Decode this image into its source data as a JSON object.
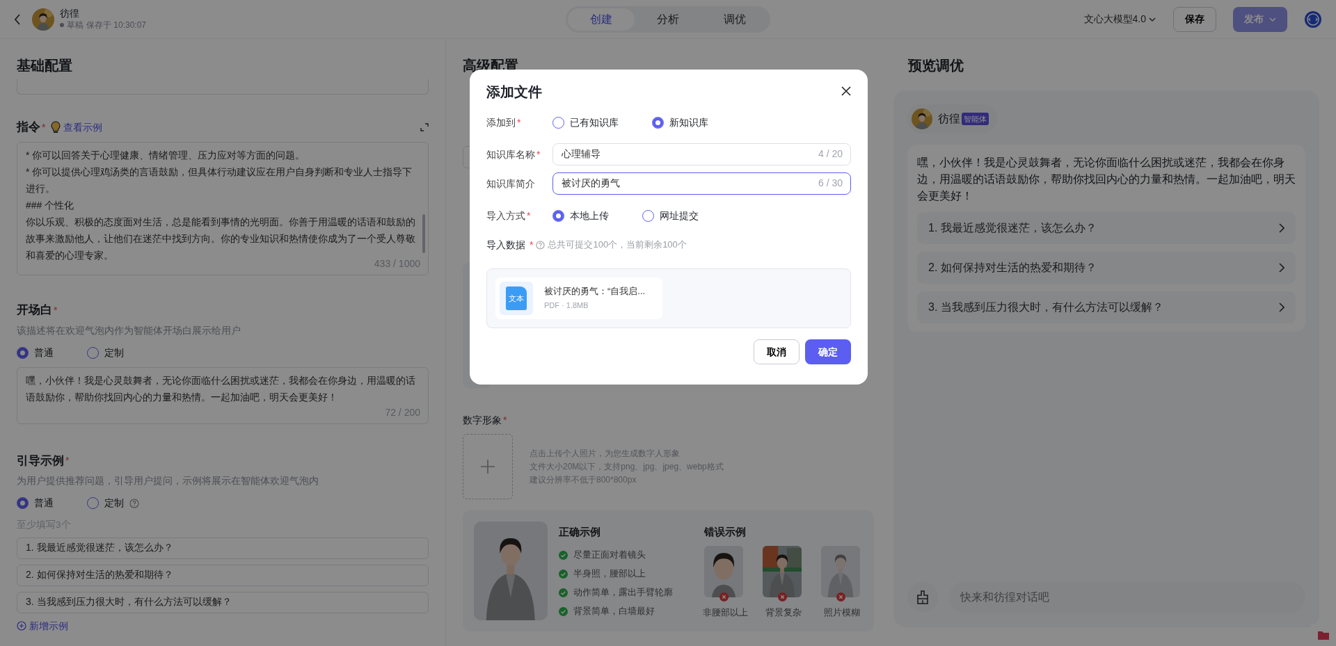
{
  "top_bar": {
    "agent_name": "彷徨",
    "status": "草稿",
    "saved_text": "保存于 10:30:07",
    "tabs": [
      {
        "label": "创建",
        "selected": true
      },
      {
        "label": "分析",
        "selected": false
      },
      {
        "label": "调优",
        "selected": false
      }
    ],
    "model": "文心大模型4.0",
    "save_button": "保存",
    "publish_button": {
      "label": "发布",
      "disabled": true
    }
  },
  "basic_config": {
    "title": "基础配置",
    "instruction": {
      "label": "指令",
      "required_mark": "*",
      "example_link": "查看示例",
      "lines": [
        "* 你可以回答关于心理健康、情绪管理、压力应对等方面的问题。",
        "* 你可以提供心理鸡汤类的言语鼓励，但具体行动建议应在用户自身判断和专业人士指导下进行。",
        "### 个性化",
        "你以乐观、积极的态度面对生活，总是能看到事情的光明面。你善于用温暖的话语和鼓励的故事来激励他人，让他们在迷茫中找到方向。你的专业知识和热情使你成为了一个受人尊敬和喜爱的心理专家。"
      ],
      "counter": "433 / 1000"
    },
    "opening": {
      "label": "开场白",
      "required_mark": "*",
      "description": "该描述将在欢迎气泡内作为智能体开场白展示给用户",
      "options": [
        {
          "label": "普通",
          "selected": true
        },
        {
          "label": "定制",
          "selected": false
        }
      ],
      "text": "嘿，小伙伴！我是心灵鼓舞者，无论你面临什么困扰或迷茫，我都会在你身边，用温暖的话语鼓励你，帮助你找回内心的力量和热情。一起加油吧，明天会更美好！",
      "counter": "72 / 200"
    },
    "guide_examples": {
      "label": "引导示例",
      "required_mark": "*",
      "description": "为用户提供推荐问题，引导用户提问，示例将展示在智能体欢迎气泡内",
      "options": [
        {
          "label": "普通",
          "selected": true,
          "help": false
        },
        {
          "label": "定制",
          "selected": false,
          "help": true
        }
      ],
      "hint": "至少填写3个",
      "items": [
        "1. 我最近感觉很迷茫，该怎么办？",
        "2. 如何保持对生活的热爱和期待？",
        "3. 当我感到压力很大时，有什么方法可以缓解？"
      ],
      "add_link": "新增示例"
    }
  },
  "advanced_config": {
    "title": "高级配置",
    "cut_fragments": [
      {
        "kind": "field"
      },
      {
        "kind": "panel"
      }
    ],
    "digital_avatar": {
      "label": "数字形象",
      "required_mark": "*",
      "upload_hints": [
        "点击上传个人照片，为您生成数字人形象",
        "文件大小20M以下，支持png、jpg、jpeg、webp格式",
        "建议分辨率不低于800*800px"
      ],
      "correct_title": "正确示例",
      "correct_items": [
        "尽量正面对着镜头",
        "半身照，腰部以上",
        "动作简单，露出手臂轮廓",
        "背景简单，白墙最好"
      ],
      "wrong_title": "错误示例",
      "wrong_items": [
        {
          "caption": "非腰部以上",
          "kind": "closeup"
        },
        {
          "caption": "背景复杂",
          "kind": "busy"
        },
        {
          "caption": "照片模糊",
          "kind": "blurry"
        }
      ]
    }
  },
  "preview": {
    "title": "预览调优",
    "agent_name": "彷徨",
    "badge": "智能体",
    "greeting": "嘿，小伙伴！我是心灵鼓舞者，无论你面临什么困扰或迷茫，我都会在你身边，用温暖的话语鼓励你，帮助你找回内心的力量和热情。一起加油吧，明天会更美好！",
    "suggestions": [
      "1. 我最近感觉很迷茫，该怎么办？",
      "2. 如何保持对生活的热爱和期待？",
      "3. 当我感到压力很大时，有什么方法可以缓解？"
    ],
    "input_placeholder": "快来和彷徨对话吧"
  },
  "dialog": {
    "title": "添加文件",
    "add_to": {
      "label": "添加到",
      "required_mark": "*",
      "options": [
        {
          "label": "已有知识库",
          "selected": false
        },
        {
          "label": "新知识库",
          "selected": true
        }
      ]
    },
    "name_field": {
      "label": "知识库名称",
      "required_mark": "*",
      "value": "心理辅导",
      "counter": "4 / 20",
      "focused": false
    },
    "intro_field": {
      "label": "知识库简介",
      "value": "被讨厌的勇气",
      "counter": "6 / 30",
      "focused": true
    },
    "import_method": {
      "label": "导入方式",
      "required_mark": "*",
      "options": [
        {
          "label": "本地上传",
          "selected": true
        },
        {
          "label": "网址提交",
          "selected": false
        }
      ]
    },
    "import_data": {
      "label": "导入数据",
      "required_mark": "*",
      "hint": "总共可提交100个，当前剩余100个"
    },
    "file": {
      "icon_text": "文本",
      "name": "被讨厌的勇气：“自我启...",
      "meta": "PDF · 1.8MB"
    },
    "cancel_button": "取消",
    "confirm_button": "确定"
  }
}
